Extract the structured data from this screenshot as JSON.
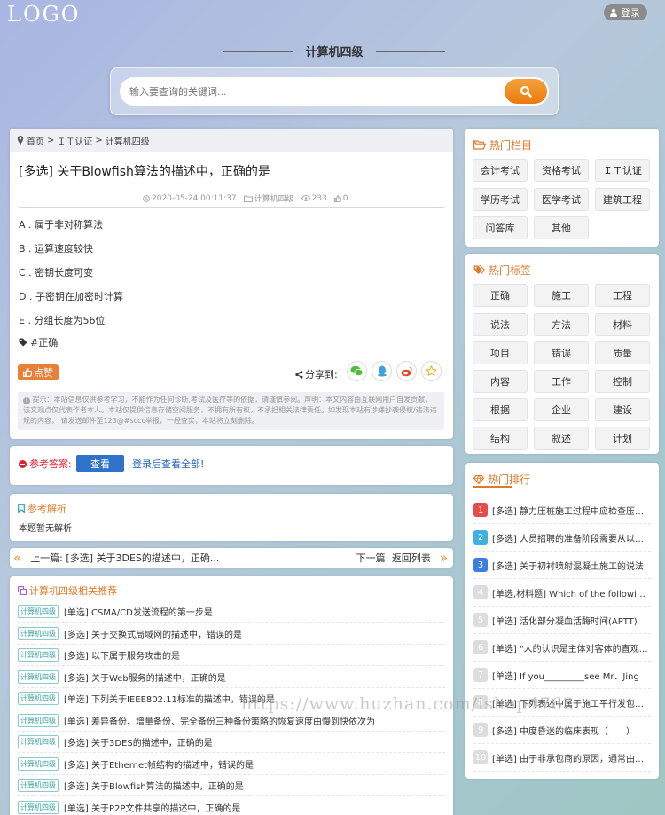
{
  "header": {
    "logo": "LOGO",
    "login_label": "登录",
    "site_title": "计算机四级"
  },
  "search": {
    "placeholder": "输入要查询的关键词..."
  },
  "breadcrumb": {
    "items": [
      "首页",
      ">",
      "ＩＴ认证",
      ">",
      "计算机四级"
    ]
  },
  "question": {
    "title": "[多选] 关于Blowfish算法的描述中，正确的是",
    "date": "2020-05-24 00:11:37",
    "category": "计算机四级",
    "views": "233",
    "likes": "0",
    "options": [
      "A . 属于非对称算法",
      "B . 运算速度较快",
      "C . 密钥长度可变",
      "D . 子密钥在加密时计算",
      "E . 分组长度为56位"
    ],
    "tag": "#正确",
    "like_label": "点赞",
    "share_label": "分享到:",
    "notice": "提示：本站信息仅供参考学习，不能作为任何诊断,考试及医疗等的依据，请谨慎参阅。声明：本文内容由互联网用户自发贡献，该文观点仅代表作者本人。本站仅提供信息存储空间服务，不拥有所有权，不承担相关法律责任。如发现本站有涉嫌抄袭侵权/违法违规的内容， 请发送邮件至123@#sccc举报，一经查实，本站将立刻删除。"
  },
  "answer": {
    "label": "参考答案:",
    "view_button": "查看",
    "login_link": "登录后查看全部!"
  },
  "analysis": {
    "title": "参考解析",
    "body": "本题暂无解析"
  },
  "nav": {
    "prev_label": "上一篇:",
    "prev_title": "[多选] 关于3DES的描述中，正确...",
    "next_label": "下一篇:",
    "next_title": "返回列表"
  },
  "recommend": {
    "title": "计算机四级相关推荐",
    "badge": "计算机四级",
    "items": [
      "[单选] CSMA/CD发送流程的第一步是",
      "[多选] 关于交换式局域网的描述中，错误的是",
      "[多选] 以下属于服务攻击的是",
      "[多选] 关于Web服务的描述中，正确的是",
      "[单选] 下列关于IEEE802.11标准的描述中，错误的是",
      "[单选] 差异备份、增量备份、完全备份三种备份策略的恢复速度由慢到快依次为",
      "[多选] 关于3DES的描述中，正确的是",
      "[多选] 关于Ethernet帧结构的描述中，错误的是",
      "[多选] 关于Blowfish算法的描述中，正确的是",
      "[单选] 关于P2P文件共享的描述中，正确的是"
    ]
  },
  "hot_columns": {
    "title": "热门栏目",
    "items": [
      "会计考试",
      "资格考试",
      "ＩＴ认证",
      "学历考试",
      "医学考试",
      "建筑工程",
      "问答库",
      "其他"
    ]
  },
  "hot_tags": {
    "title": "热门标签",
    "items": [
      "正确",
      "施工",
      "工程",
      "说法",
      "方法",
      "材料",
      "项目",
      "错误",
      "质量",
      "内容",
      "工作",
      "控制",
      "根据",
      "企业",
      "建设",
      "结构",
      "叙述",
      "计划"
    ]
  },
  "hot_rank": {
    "title": "热门排行",
    "items": [
      {
        "n": "1",
        "text": "[多选] 静力压桩施工过程中应检查压力、桩垂直度"
      },
      {
        "n": "2",
        "text": "[多选] 人员招聘的准备阶段需要从以下方面入手"
      },
      {
        "n": "3",
        "text": "[多选] 关于初衬喷射混凝土施工的说法"
      },
      {
        "n": "4",
        "text": "[单选,材料题] Which of the following is"
      },
      {
        "n": "5",
        "text": "[单选] 活化部分凝血活酶时间(APTT)"
      },
      {
        "n": "6",
        "text": "[单选] \"人的认识是主体对客体的直观反映\""
      },
      {
        "n": "7",
        "text": "[单选] If you_________see Mr．Jing"
      },
      {
        "n": "8",
        "text": "[单选] 下列表述中属于施工平行发包模式"
      },
      {
        "n": "9",
        "text": "[多选] 中度昏迷的临床表现（　　）"
      },
      {
        "n": "10",
        "text": "[单选] 由于非承包商的原因，通常由发包人"
      }
    ]
  },
  "watermark": "https://www.huzhan.com/ishop4762",
  "colors": {
    "accent": "#e07a2b",
    "primary": "#2e73c9",
    "rank1": "#e94b4b",
    "rank2": "#3fb0e0",
    "rank3": "#3a7ee0"
  }
}
